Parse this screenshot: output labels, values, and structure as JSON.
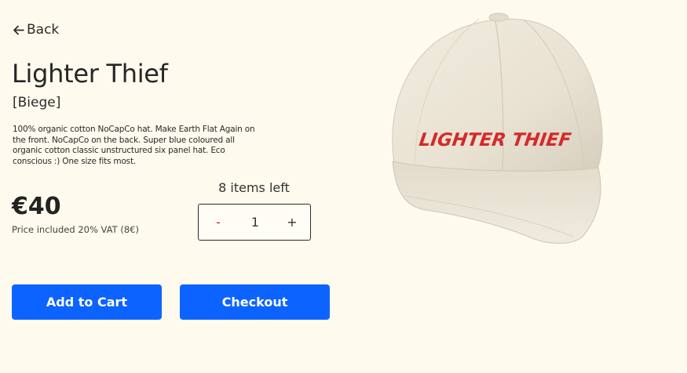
{
  "nav": {
    "back_label": "Back"
  },
  "product": {
    "title": "Lighter Thief",
    "variant": "[Biege]",
    "description": "100% organic cotton NoCapCo hat. Make Earth Flat Again on the front. NoCapCo on the back. Super blue coloured all organic cotton classic unstructured six panel hat. Eco conscious :) One size fits most.",
    "price": "€40",
    "vat_note": "Price included 20% VAT (8€)",
    "image_print_text": "LIGHTER THIEF"
  },
  "quantity": {
    "stock_label": "8 items left",
    "minus_label": "-",
    "value": "1",
    "plus_label": "+"
  },
  "actions": {
    "add_to_cart_label": "Add to Cart",
    "checkout_label": "Checkout"
  },
  "colors": {
    "background": "#fefaed",
    "primary_button": "#0d63ff",
    "minus_accent": "#d91f26",
    "print_red": "#d42a2a",
    "cap_beige": "#ece6d8"
  },
  "icons": {
    "back": "arrow-left-icon"
  }
}
